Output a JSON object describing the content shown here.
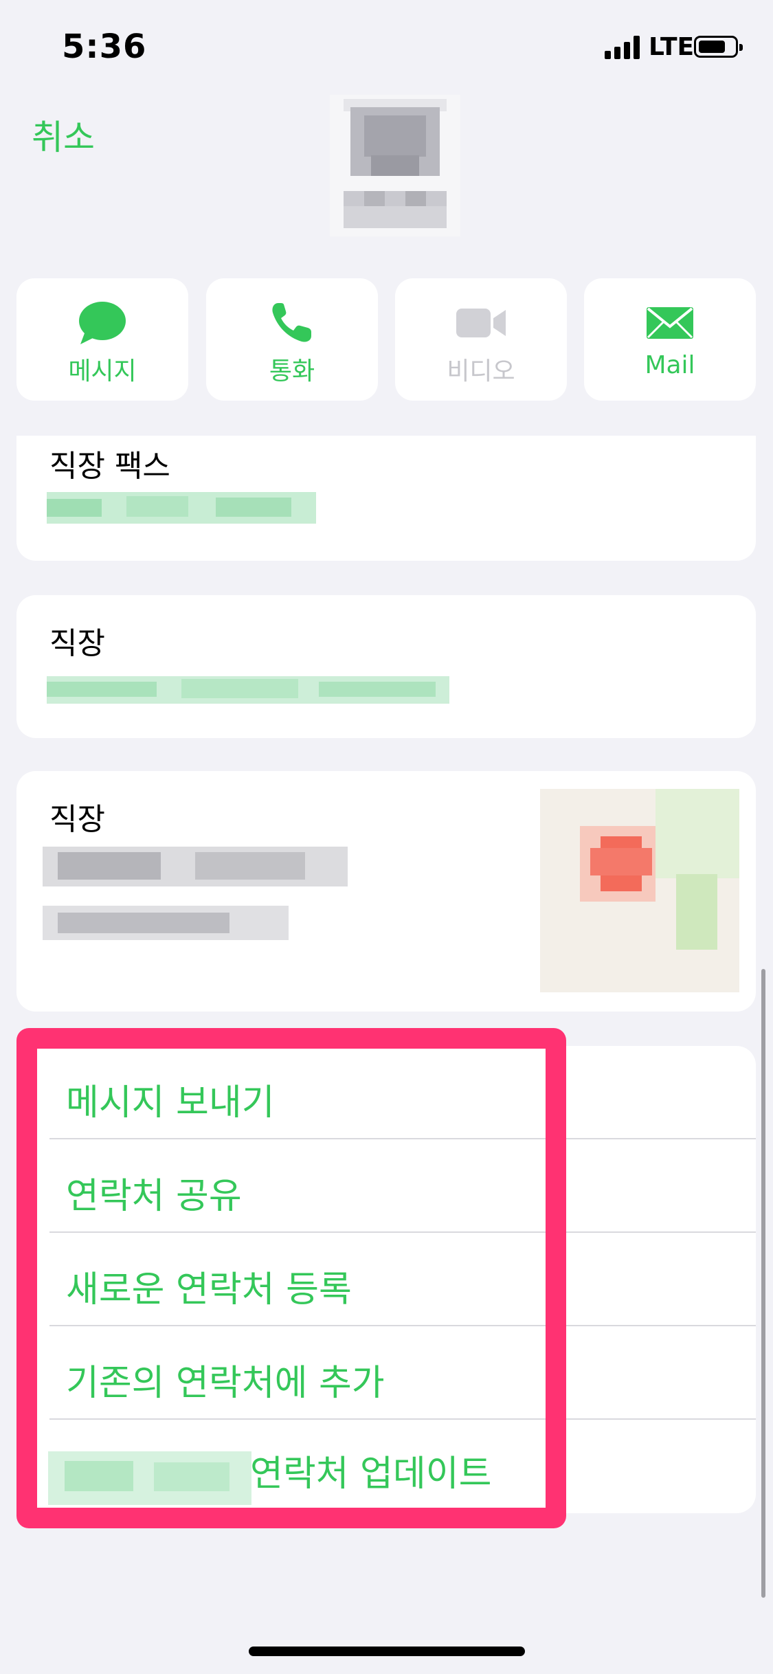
{
  "status_bar": {
    "time": "5:36",
    "network": "LTE"
  },
  "header": {
    "cancel_label": "취소"
  },
  "actions": [
    {
      "label": "메시지",
      "icon": "message-bubble-icon",
      "enabled": true
    },
    {
      "label": "통화",
      "icon": "phone-icon",
      "enabled": true
    },
    {
      "label": "비디오",
      "icon": "video-camera-icon",
      "enabled": false
    },
    {
      "label": "Mail",
      "icon": "envelope-icon",
      "enabled": true
    }
  ],
  "fields": [
    {
      "label": "직장 팩스"
    },
    {
      "label": "직장"
    },
    {
      "label": "직장"
    }
  ],
  "options": [
    {
      "label": "메시지 보내기"
    },
    {
      "label": "연락처 공유"
    },
    {
      "label": "새로운 연락처 등록"
    },
    {
      "label": "기존의 연락처에 추가"
    },
    {
      "label": "연락처 업데이트"
    }
  ],
  "colors": {
    "accent": "#34c759",
    "disabled": "#c7c7cc",
    "highlight": "#ff3272",
    "background": "#f2f2f7"
  }
}
